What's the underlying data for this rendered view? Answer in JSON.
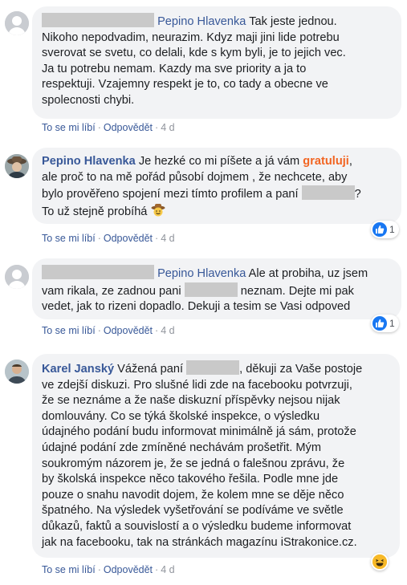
{
  "comments": [
    {
      "author": "Pepino Hlavenka",
      "text_lines": [
        "Tak jeste jednou.",
        "Nikoho nepodvadim, neurazim. Kdyz maji jini lide potrebu",
        "sverovat se svetu, co delali, kde s kym byli, je to jejich vec.",
        "Ja tu potrebu nemam. Kazdy ma sve priority a ja to",
        "respektuji. Vzajemny respekt je to, co tady a obecne ve",
        "spolecnosti chybi."
      ],
      "like_label": "To se mi líbí",
      "reply_label": "Odpovědět",
      "time": "4 d"
    },
    {
      "author": "Pepino Hlavenka",
      "text_a": "Je hezké co mi píšete a já vám",
      "highlight": "gratuluji",
      "text_b": ",",
      "line2": "ale proč to na mě pořád působí dojmem , že nechcete, aby",
      "line3_a": "bylo prověřeno spojení mezi tímto profilem a paní",
      "line3_b": "?",
      "line4": "To už stejně probíhá",
      "like_label": "To se mi líbí",
      "reply_label": "Odpovědět",
      "time": "4 d",
      "reaction_count": "1"
    },
    {
      "author": "Pepino Hlavenka",
      "text_a": "Ale at probiha, uz jsem",
      "line2_a": "vam rikala, ze zadnou pani",
      "line2_b": "neznam. Dejte mi pak",
      "line3": "vedet, jak to rizeni dopadlo. Dekuji a tesim se Vasi odpoved",
      "like_label": "To se mi líbí",
      "reply_label": "Odpovědět",
      "time": "4 d",
      "reaction_count": "1"
    },
    {
      "author": "Karel Janský",
      "text_a": "Vážená paní",
      "text_b": ", děkuji za Vaše postoje",
      "text_lines": [
        "ve zdejší diskuzi. Pro slušné lidi zde na facebooku potvrzuji,",
        "že se neznáme a že naše diskuzní příspěvky nejsou nijak",
        "domlouvány. Co se týká školské inspekce, o výsledku",
        "údajného podání budu informovat minimálně já sám, protože",
        "údajné podání zde zmíněné nechávám prošetřit. Mým",
        "soukromým názorem je, že se jedná o falešnou zprávu, že",
        "by školská inspekce něco takového řešila. Podle mne jde",
        "pouze o snahu navodit dojem, že kolem mne se děje něco",
        "špatného. Na výsledek vyšetřování se podíváme ve světle",
        "důkazů, faktů a souvislostí a o výsledku budeme informovat",
        "jak na facebooku, tak na stránkách magazínu iStrakonice.cz."
      ],
      "like_label": "To se mi líbí",
      "reply_label": "Odpovědět",
      "time": "4 d"
    }
  ],
  "actions_sep": "·",
  "icons": {
    "like": "thumbs-up-icon",
    "haha": "laughing-face-icon",
    "cowboy": "cowboy-emoji-icon"
  },
  "colors": {
    "accent": "#385898",
    "bubble": "#f2f3f5",
    "like": "#1877f2",
    "highlight": "#f26522"
  }
}
